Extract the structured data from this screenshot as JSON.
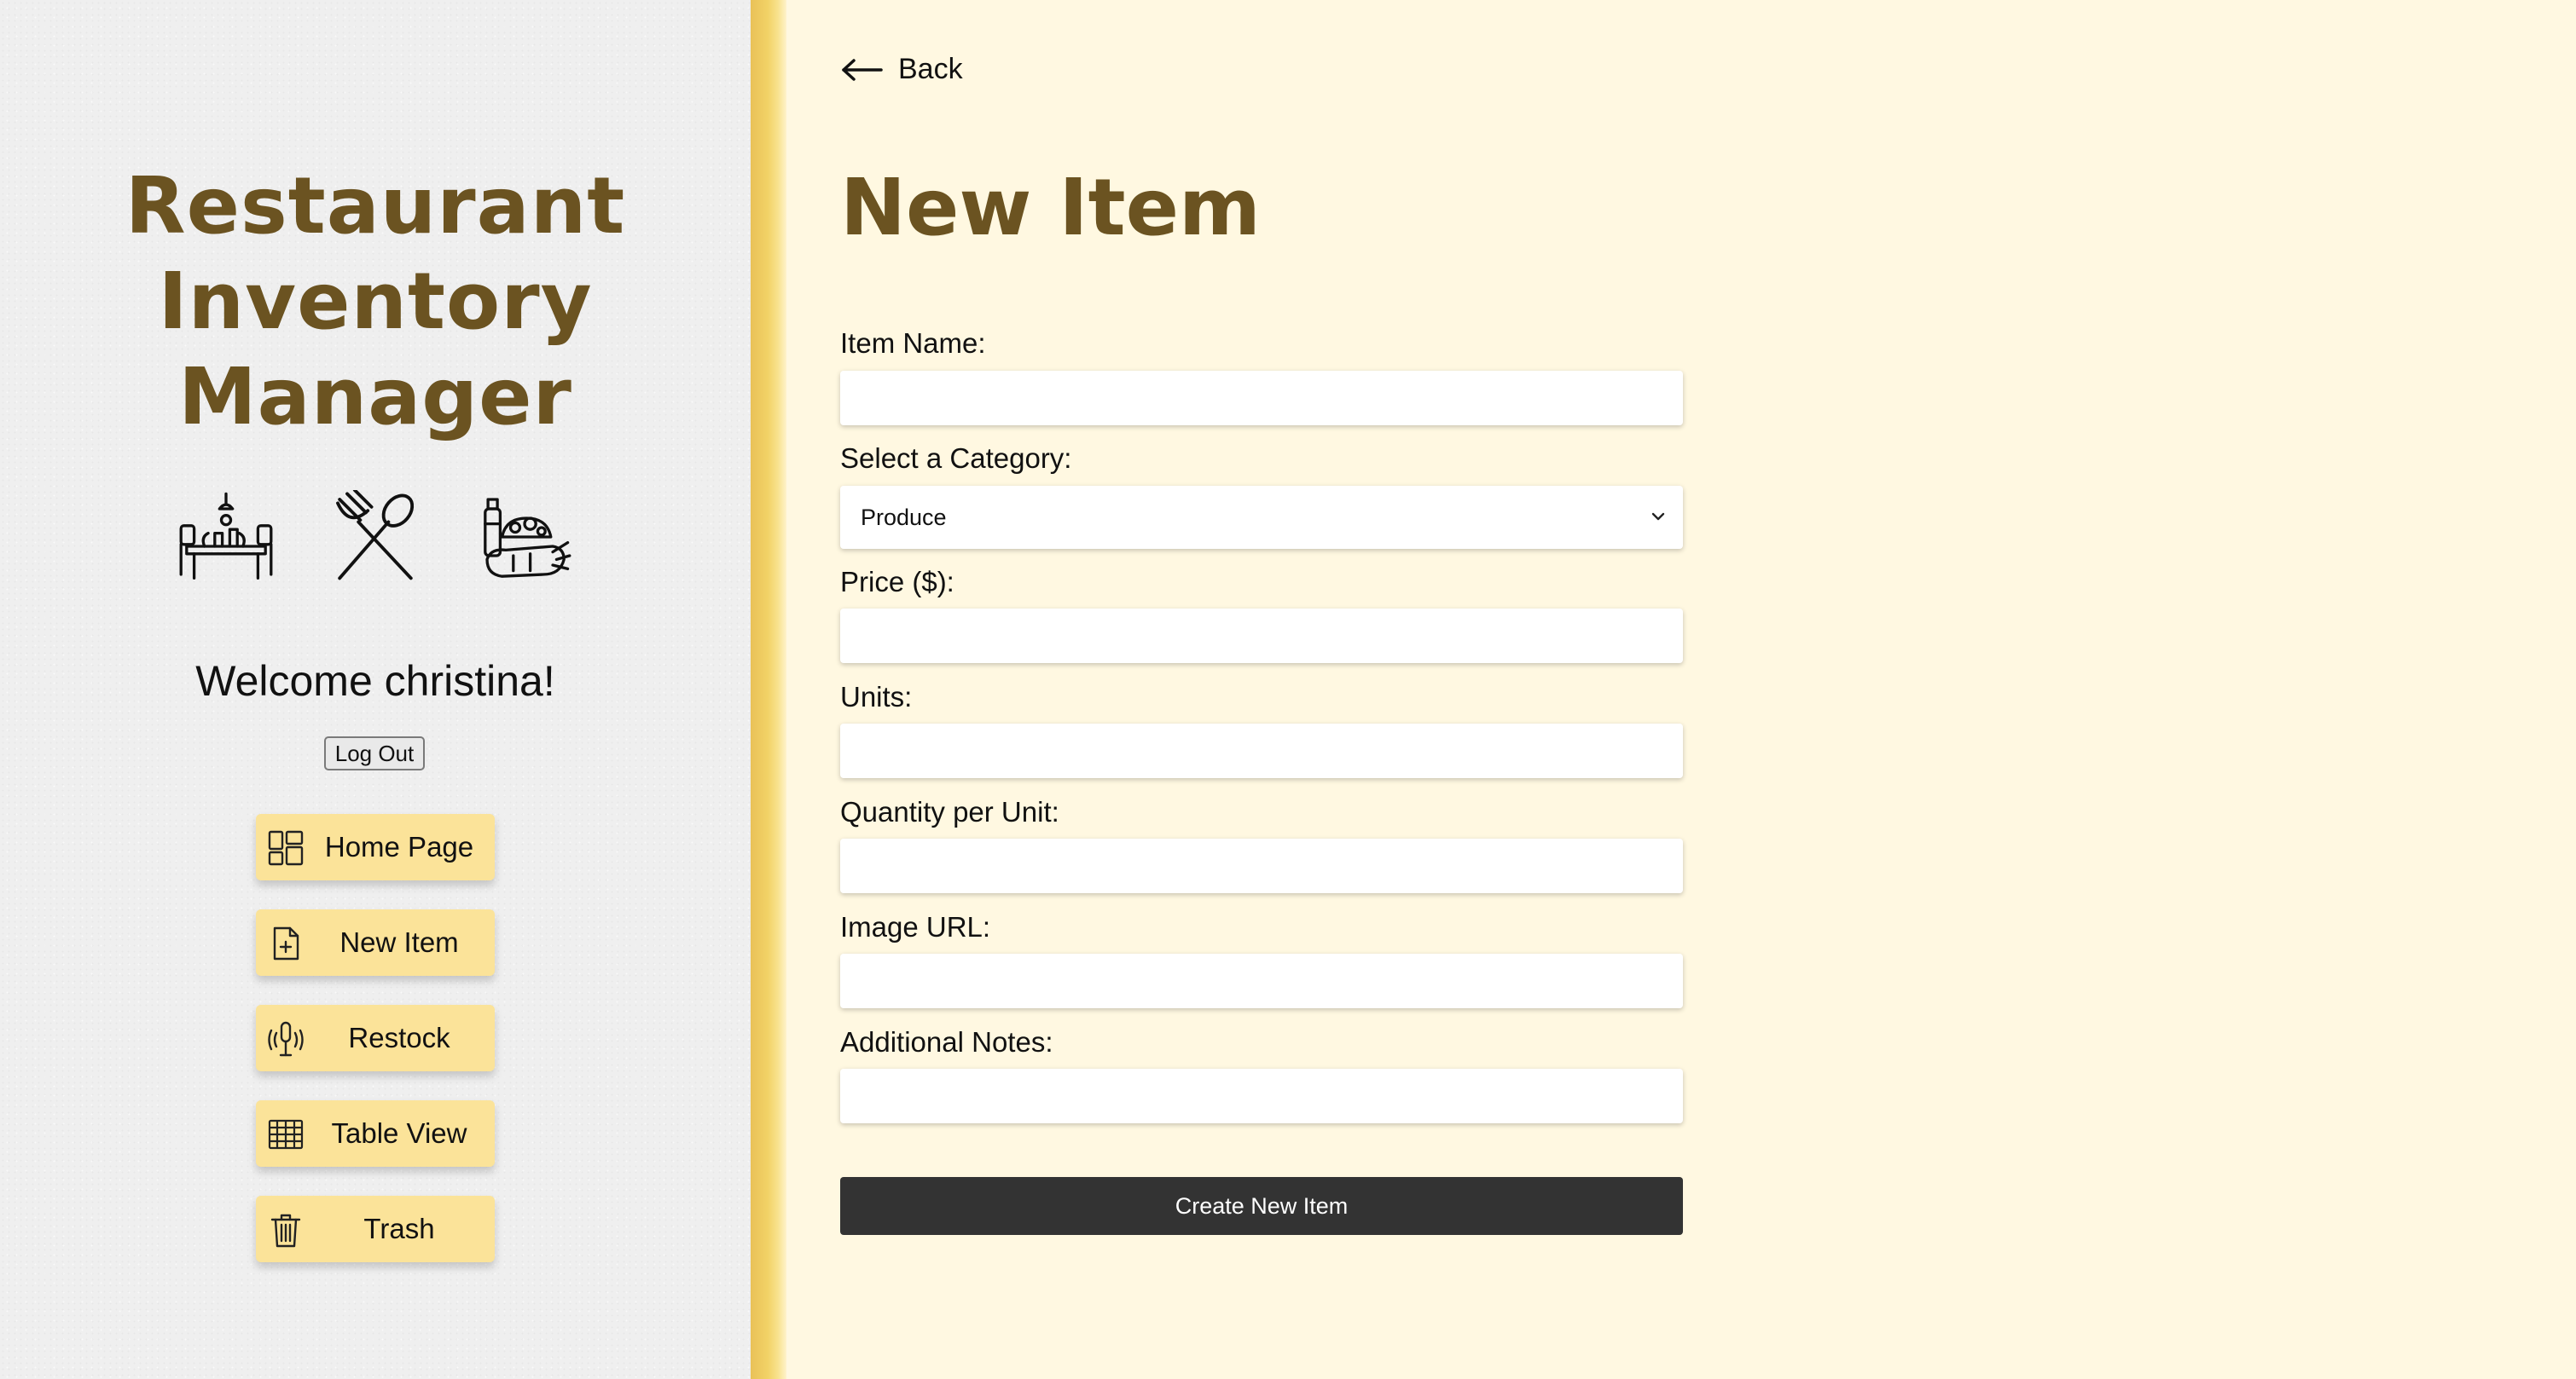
{
  "sidebar": {
    "app_title": [
      "Restaurant",
      "Inventory",
      "Manager"
    ],
    "icons": [
      "dining-table-icon",
      "fork-spoon-icon",
      "grocery-bag-icon"
    ],
    "welcome": "Welcome christina!",
    "logout_label": "Log Out",
    "nav": [
      {
        "label": "Home Page",
        "icon": "dashboard-icon"
      },
      {
        "label": "New Item",
        "icon": "new-file-icon"
      },
      {
        "label": "Restock",
        "icon": "restock-icon"
      },
      {
        "label": "Table View",
        "icon": "table-icon"
      },
      {
        "label": "Trash",
        "icon": "trash-icon"
      }
    ]
  },
  "main": {
    "back_label": "Back",
    "title": "New Item",
    "form": {
      "item_name": {
        "label": "Item Name:",
        "value": ""
      },
      "category": {
        "label": "Select a Category:",
        "selected": "Produce"
      },
      "price": {
        "label": "Price ($):",
        "value": ""
      },
      "units": {
        "label": "Units:",
        "value": ""
      },
      "quantity_per_unit": {
        "label": "Quantity per Unit:",
        "value": ""
      },
      "image_url": {
        "label": "Image URL:",
        "value": ""
      },
      "notes": {
        "label": "Additional Notes:",
        "value": ""
      },
      "submit_label": "Create New Item"
    }
  },
  "colors": {
    "accent_brown": "#6b5321",
    "nav_button": "#fbe399",
    "stripe": "#f2d266",
    "main_background": "#fff8e1",
    "submit_button": "#333333"
  }
}
